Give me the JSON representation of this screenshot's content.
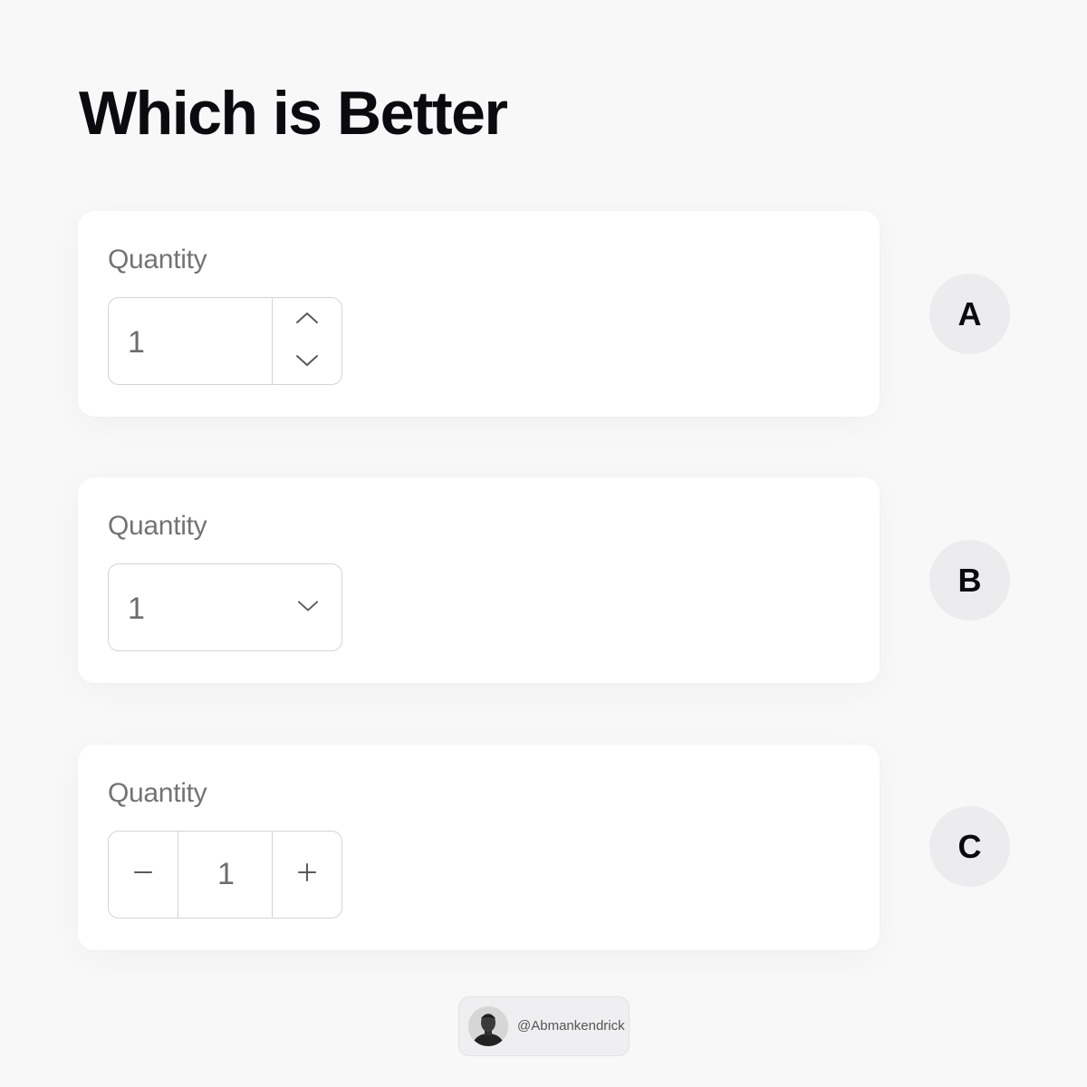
{
  "page": {
    "title": "Which is Better"
  },
  "options": [
    {
      "badge": "A",
      "label": "Quantity",
      "variant": "number-input-with-arrows",
      "value": "1",
      "icons": [
        "chevron-up-icon",
        "chevron-down-icon"
      ]
    },
    {
      "badge": "B",
      "label": "Quantity",
      "variant": "select-dropdown",
      "value": "1",
      "icons": [
        "chevron-down-icon"
      ]
    },
    {
      "badge": "C",
      "label": "Quantity",
      "variant": "minus-plus-stepper",
      "value": "1",
      "icons": [
        "minus-icon",
        "plus-icon"
      ]
    }
  ],
  "credit": {
    "handle": "@Abmankendrick",
    "avatar_icon": "avatar-photo"
  },
  "colors": {
    "background": "#f8f8f8",
    "card": "#ffffff",
    "border": "#d4d4d6",
    "label": "#737373",
    "value": "#6d6d6d",
    "badge_bg": "#ececee",
    "title": "#0b0b0f"
  }
}
